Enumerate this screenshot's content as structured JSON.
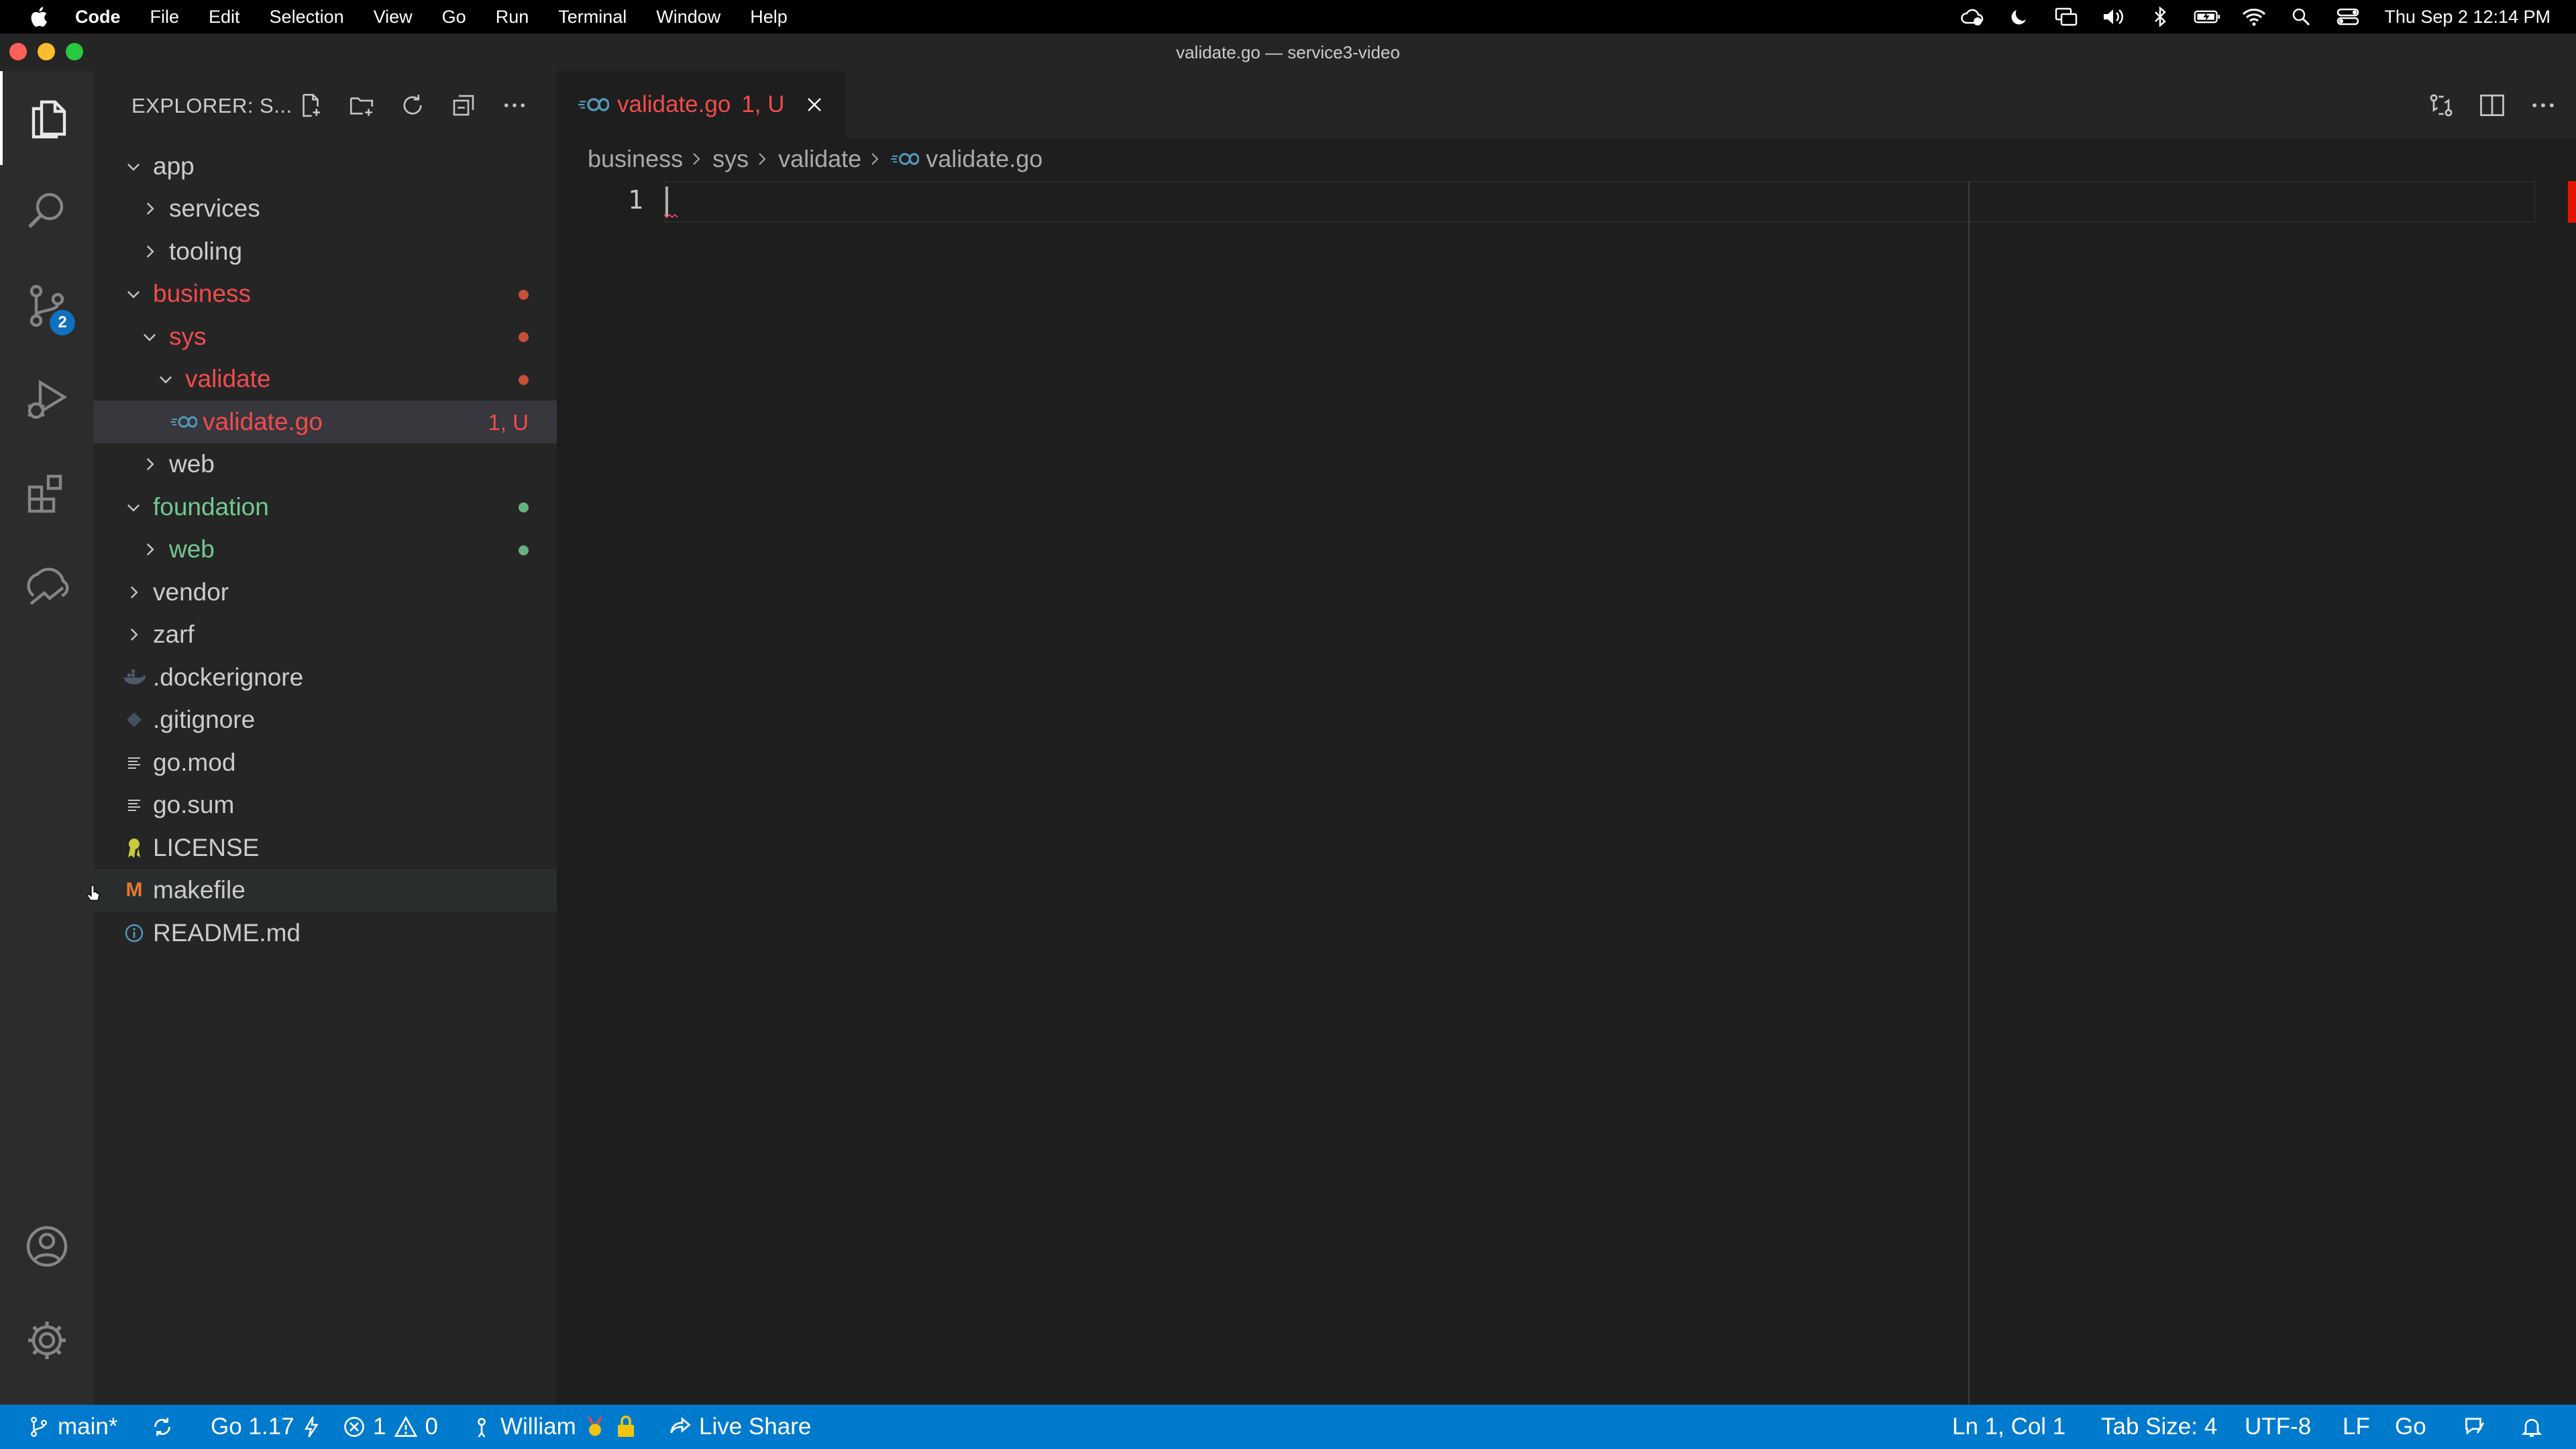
{
  "menubar": {
    "app": "Code",
    "items": [
      "File",
      "Edit",
      "Selection",
      "View",
      "Go",
      "Run",
      "Terminal",
      "Window",
      "Help"
    ],
    "clock": "Thu Sep 2  12:14 PM"
  },
  "window": {
    "title": "validate.go — service3-video"
  },
  "activity": {
    "scm_badge": "2"
  },
  "sidebar": {
    "title": "EXPLORER: S...",
    "tree": [
      {
        "label": "app",
        "type": "folder",
        "open": true
      },
      {
        "label": "services",
        "type": "folder",
        "open": false
      },
      {
        "label": "tooling",
        "type": "folder",
        "open": false
      },
      {
        "label": "business",
        "type": "folder",
        "open": true
      },
      {
        "label": "sys",
        "type": "folder",
        "open": true
      },
      {
        "label": "validate",
        "type": "folder",
        "open": true
      },
      {
        "label": "validate.go",
        "type": "file",
        "status": "1, U"
      },
      {
        "label": "web",
        "type": "folder",
        "open": false
      },
      {
        "label": "foundation",
        "type": "folder",
        "open": true
      },
      {
        "label": "web",
        "type": "folder",
        "open": false
      },
      {
        "label": "vendor",
        "type": "folder",
        "open": false
      },
      {
        "label": "zarf",
        "type": "folder",
        "open": false
      },
      {
        "label": ".dockerignore",
        "type": "file"
      },
      {
        "label": ".gitignore",
        "type": "file"
      },
      {
        "label": "go.mod",
        "type": "file"
      },
      {
        "label": "go.sum",
        "type": "file"
      },
      {
        "label": "LICENSE",
        "type": "file"
      },
      {
        "label": "makefile",
        "type": "file"
      },
      {
        "label": "README.md",
        "type": "file"
      }
    ]
  },
  "editor": {
    "tab": {
      "name": "validate.go",
      "status": "1, U"
    },
    "breadcrumbs": [
      "business",
      "sys",
      "validate",
      "validate.go"
    ],
    "line_number": "1"
  },
  "statusbar": {
    "branch": "main*",
    "go_version": "Go 1.17",
    "errors": "1",
    "warnings": "0",
    "user": "William",
    "live_share": "Live Share",
    "position": "Ln 1, Col 1",
    "tab_size": "Tab Size: 4",
    "encoding": "UTF-8",
    "eol": "LF",
    "language": "Go"
  },
  "colors": {
    "accent": "#007acc",
    "error_red": "#f14c4c",
    "added_green": "#73c991"
  }
}
